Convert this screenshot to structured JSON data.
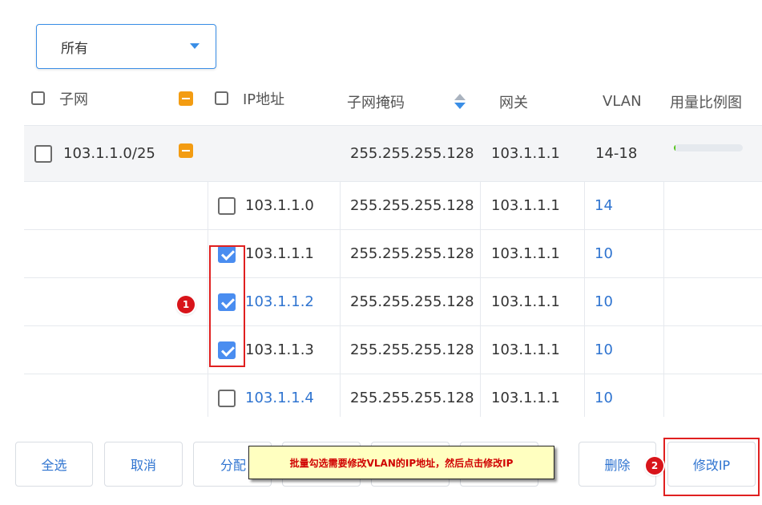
{
  "filter": {
    "selected": "所有"
  },
  "columns": {
    "subnet": "子网",
    "ip": "IP地址",
    "mask": "子网掩码",
    "gateway": "网关",
    "vlan": "VLAN",
    "usage": "用量比例图"
  },
  "group": {
    "subnet": "103.1.1.0/25",
    "mask": "255.255.255.128",
    "gateway": "103.1.1.1",
    "vlan": "14-18",
    "usage_fraction": 0.02
  },
  "rows": [
    {
      "ip": "103.1.1.0",
      "mask": "255.255.255.128",
      "gateway": "103.1.1.1",
      "vlan": "14",
      "checked": false
    },
    {
      "ip": "103.1.1.1",
      "mask": "255.255.255.128",
      "gateway": "103.1.1.1",
      "vlan": "10",
      "checked": true
    },
    {
      "ip": "103.1.1.2",
      "mask": "255.255.255.128",
      "gateway": "103.1.1.1",
      "vlan": "10",
      "checked": true
    },
    {
      "ip": "103.1.1.3",
      "mask": "255.255.255.128",
      "gateway": "103.1.1.1",
      "vlan": "10",
      "checked": true
    },
    {
      "ip": "103.1.1.4",
      "mask": "255.255.255.128",
      "gateway": "103.1.1.1",
      "vlan": "10",
      "checked": false
    }
  ],
  "buttons": {
    "select_all": "全选",
    "cancel": "取消",
    "assign": "分配",
    "delete": "删除",
    "modify_ip": "修改IP"
  },
  "annotations": {
    "badge1": "1",
    "badge2": "2",
    "tooltip": "批量勾选需要修改VLAN的IP地址，然后点击修改IP"
  },
  "colors": {
    "accent": "#2f74d0",
    "checkbox_checked": "#4a8df0",
    "indeterminate": "#f39c12",
    "highlight_box": "#e02020",
    "tooltip_bg": "#ffffc0"
  }
}
